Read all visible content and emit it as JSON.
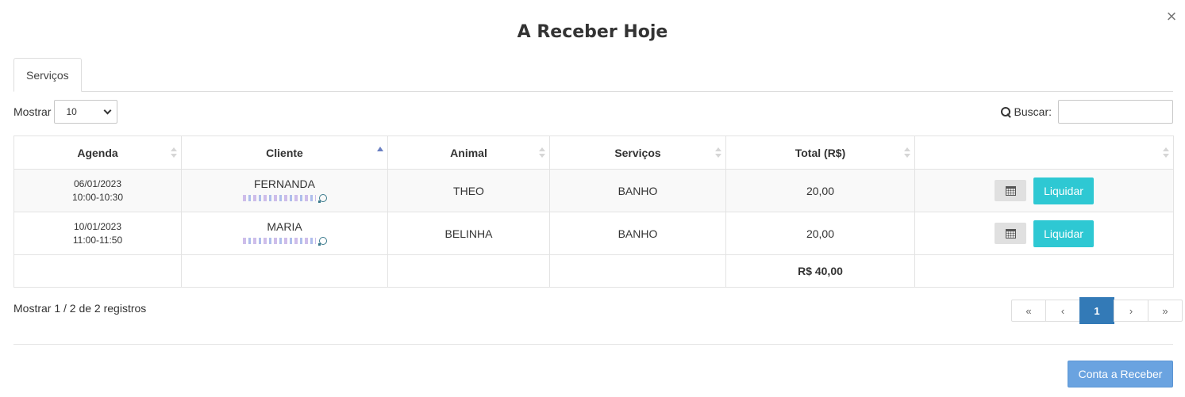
{
  "modal": {
    "title": "A Receber Hoje",
    "close_glyph": "×"
  },
  "tabs": [
    {
      "label": "Serviços"
    }
  ],
  "length_control": {
    "label": "Mostrar",
    "selected": "10"
  },
  "search": {
    "label": "Buscar:",
    "value": ""
  },
  "table": {
    "headers": [
      "Agenda",
      "Cliente",
      "Animal",
      "Serviços",
      "Total (R$)",
      ""
    ],
    "sort_column": "Cliente",
    "rows": [
      {
        "date": "06/01/2023",
        "time": "10:00-10:30",
        "client": "FERNANDA",
        "animal": "THEO",
        "service": "BANHO",
        "total": "20,00",
        "action": "Liquidar"
      },
      {
        "date": "10/01/2023",
        "time": "11:00-11:50",
        "client": "MARIA",
        "animal": "BELINHA",
        "service": "BANHO",
        "total": "20,00",
        "action": "Liquidar"
      }
    ],
    "footer_total": "R$ 40,00"
  },
  "info": "Mostrar 1 / 2 de 2 registros",
  "pagination": {
    "first": "«",
    "prev": "‹",
    "current": "1",
    "next": "›",
    "last": "»"
  },
  "footer": {
    "button_label": "Conta a Receber"
  },
  "colors": {
    "accent_cyan": "#2ec8d3",
    "page_active": "#337ab7",
    "primary_button": "#6aa3e0"
  }
}
